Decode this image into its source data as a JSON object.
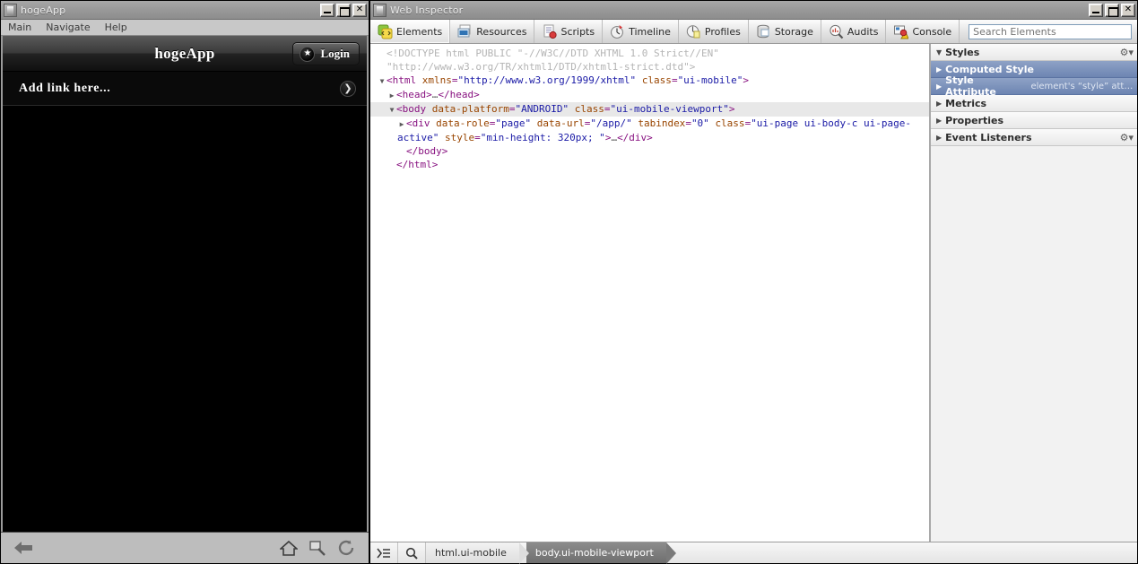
{
  "app_window": {
    "title": "hogeApp",
    "icon": "app-icon",
    "window_buttons": [
      {
        "name": "minimize",
        "glyph": "_"
      },
      {
        "name": "maximize",
        "glyph": "□"
      },
      {
        "name": "close",
        "glyph": "✕"
      }
    ],
    "menu": [
      "Main",
      "Navigate",
      "Help"
    ],
    "page": {
      "header_title": "hogeApp",
      "login_label": "Login",
      "login_icon": "star-icon",
      "list_items": [
        {
          "label": "Add link here...",
          "chevron": "❯"
        }
      ]
    },
    "bottom_bar": {
      "back_icon": "⬅",
      "home_icon": "home-icon",
      "search_icon": "magnifier-icon",
      "refresh_icon": "⟳"
    }
  },
  "inspector_window": {
    "title": "Web Inspector",
    "window_buttons": [
      {
        "name": "minimize",
        "glyph": "_"
      },
      {
        "name": "maximize",
        "glyph": "□"
      },
      {
        "name": "close",
        "glyph": "✕"
      }
    ],
    "tabs": [
      {
        "label": "Elements",
        "icon": "elements-icon",
        "active": true
      },
      {
        "label": "Resources",
        "icon": "resources-icon",
        "active": false
      },
      {
        "label": "Scripts",
        "icon": "scripts-icon",
        "active": false
      },
      {
        "label": "Timeline",
        "icon": "timeline-icon",
        "active": false
      },
      {
        "label": "Profiles",
        "icon": "profiles-icon",
        "active": false
      },
      {
        "label": "Storage",
        "icon": "storage-icon",
        "active": false
      },
      {
        "label": "Audits",
        "icon": "audits-icon",
        "active": false
      },
      {
        "label": "Console",
        "icon": "console-icon",
        "active": false
      }
    ],
    "search": {
      "placeholder": "Search Elements",
      "value": ""
    },
    "dom_tree": {
      "lines": [
        {
          "id": "doctype",
          "indent": 0,
          "twisty": "",
          "tokens": [
            {
              "cls": "c-doctype",
              "t": "<!DOCTYPE html PUBLIC \"-//W3C//DTD XHTML 1.0 Strict//EN\""
            }
          ]
        },
        {
          "id": "doctype2",
          "indent": 0,
          "twisty": "",
          "tokens": [
            {
              "cls": "c-doctype",
              "t": "\"http://www.w3.org/TR/xhtml1/DTD/xhtml1-strict.dtd\">"
            }
          ]
        },
        {
          "id": "html-open",
          "indent": 0,
          "twisty": "▼",
          "tokens": [
            {
              "cls": "c-tag",
              "t": "<html "
            },
            {
              "cls": "c-attr",
              "t": "xmlns"
            },
            {
              "cls": "c-punc",
              "t": "="
            },
            {
              "cls": "c-val",
              "t": "\"http://www.w3.org/1999/xhtml\""
            },
            {
              "cls": "c-tag",
              "t": " "
            },
            {
              "cls": "c-attr",
              "t": "class"
            },
            {
              "cls": "c-punc",
              "t": "="
            },
            {
              "cls": "c-val",
              "t": "\"ui-mobile\""
            },
            {
              "cls": "c-tag",
              "t": ">"
            }
          ]
        },
        {
          "id": "head",
          "indent": 1,
          "twisty": "▶",
          "tokens": [
            {
              "cls": "c-tag",
              "t": "<head>"
            },
            {
              "cls": "c-ell",
              "t": "…"
            },
            {
              "cls": "c-tag",
              "t": "</head>"
            }
          ]
        },
        {
          "id": "body-open",
          "indent": 1,
          "twisty": "▼",
          "selected": true,
          "tokens": [
            {
              "cls": "c-tag",
              "t": "<body "
            },
            {
              "cls": "c-attr",
              "t": "data-platform"
            },
            {
              "cls": "c-punc",
              "t": "="
            },
            {
              "cls": "c-val",
              "t": "\"ANDROID\""
            },
            {
              "cls": "c-tag",
              "t": " "
            },
            {
              "cls": "c-attr",
              "t": "class"
            },
            {
              "cls": "c-punc",
              "t": "="
            },
            {
              "cls": "c-val",
              "t": "\"ui-mobile-viewport\""
            },
            {
              "cls": "c-tag",
              "t": ">"
            }
          ]
        },
        {
          "id": "div-page",
          "indent": 2,
          "twisty": "▶",
          "tokens": [
            {
              "cls": "c-tag",
              "t": "<div "
            },
            {
              "cls": "c-attr",
              "t": "data-role"
            },
            {
              "cls": "c-punc",
              "t": "="
            },
            {
              "cls": "c-val",
              "t": "\"page\""
            },
            {
              "cls": "c-tag",
              "t": " "
            },
            {
              "cls": "c-attr",
              "t": "data-url"
            },
            {
              "cls": "c-punc",
              "t": "="
            },
            {
              "cls": "c-val",
              "t": "\"/app/\""
            },
            {
              "cls": "c-tag",
              "t": " "
            },
            {
              "cls": "c-attr",
              "t": "tabindex"
            },
            {
              "cls": "c-punc",
              "t": "="
            },
            {
              "cls": "c-val",
              "t": "\"0\""
            },
            {
              "cls": "c-tag",
              "t": " "
            },
            {
              "cls": "c-attr",
              "t": "class"
            },
            {
              "cls": "c-punc",
              "t": "="
            },
            {
              "cls": "c-val",
              "t": "\"ui-page ui-body-c ui-page-active\""
            },
            {
              "cls": "c-tag",
              "t": " "
            },
            {
              "cls": "c-attr",
              "t": "style"
            },
            {
              "cls": "c-punc",
              "t": "="
            },
            {
              "cls": "c-val",
              "t": "\"min-height: 320px; \""
            },
            {
              "cls": "c-tag",
              "t": ">"
            },
            {
              "cls": "c-ell",
              "t": "…"
            },
            {
              "cls": "c-tag",
              "t": "</div>"
            }
          ]
        },
        {
          "id": "body-close",
          "indent": 2,
          "twisty": "",
          "tokens": [
            {
              "cls": "c-tag",
              "t": "</body>"
            }
          ]
        },
        {
          "id": "html-close",
          "indent": 1,
          "twisty": "",
          "tokens": [
            {
              "cls": "c-tag",
              "t": "</html>"
            }
          ]
        }
      ]
    },
    "styles_panel": {
      "sections": [
        {
          "label": "Styles",
          "twisty": "▼",
          "gear": "⚙",
          "selected": false,
          "sub": ""
        },
        {
          "label": "Computed Style",
          "twisty": "▶",
          "gear": "",
          "selected": true,
          "sub": ""
        },
        {
          "label": "Style Attribute",
          "twisty": "▶",
          "gear": "",
          "selected": true,
          "sub": "element's “style” attri⋯"
        },
        {
          "label": "Metrics",
          "twisty": "▶",
          "gear": "",
          "selected": false,
          "sub": ""
        },
        {
          "label": "Properties",
          "twisty": "▶",
          "gear": "",
          "selected": false,
          "sub": ""
        },
        {
          "label": "Event Listeners",
          "twisty": "▶",
          "gear": "⚙",
          "selected": false,
          "sub": ""
        }
      ]
    },
    "status_bar": {
      "dock_icon": "dock-to-side-icon",
      "search_icon": "magnifier-icon",
      "breadcrumbs": [
        {
          "label": "html.ui-mobile",
          "current": false
        },
        {
          "label": "body.ui-mobile-viewport",
          "current": true
        }
      ]
    }
  }
}
